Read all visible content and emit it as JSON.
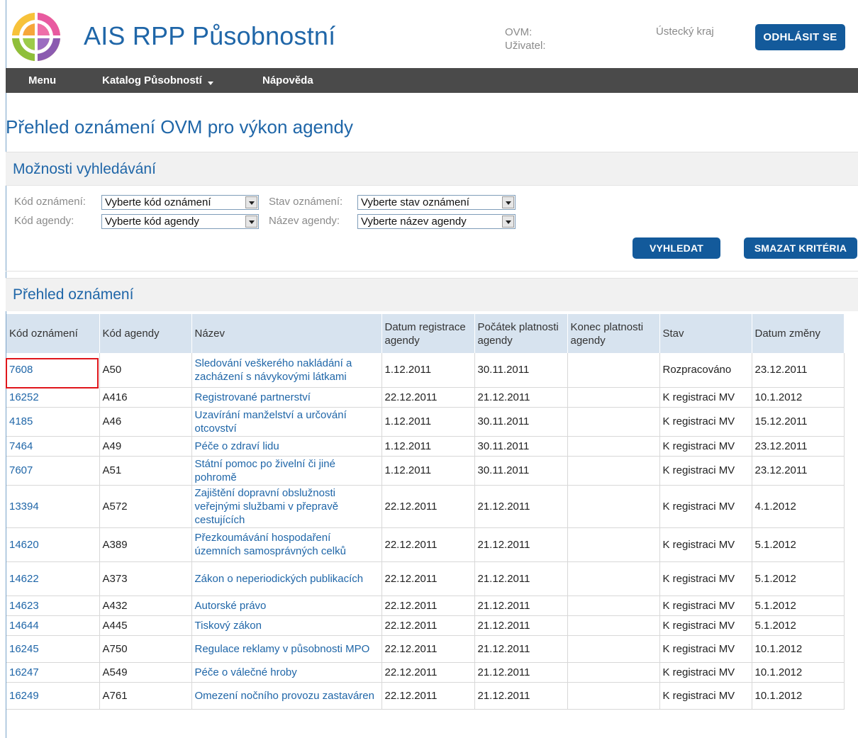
{
  "header": {
    "app_title": "AIS RPP Působnostní",
    "ovm_label": "OVM:",
    "user_label": "Uživatel:",
    "region": "Ústecký kraj",
    "logout_label": "ODHLÁSIT SE"
  },
  "nav": {
    "items": [
      {
        "label": "Menu"
      },
      {
        "label": "Katalog Působností"
      },
      {
        "label": "Nápověda"
      }
    ]
  },
  "page_title": "Přehled oznámení OVM pro výkon agendy",
  "search": {
    "title": "Možnosti vyhledávání",
    "kod_oznameni_label": "Kód oznámení:",
    "kod_oznameni_value": "Vyberte kód oznámení",
    "kod_agendy_label": "Kód agendy:",
    "kod_agendy_value": "Vyberte kód agendy",
    "stav_label": "Stav oznámení:",
    "stav_value": "Vyberte stav oznámení",
    "nazev_label": "Název agendy:",
    "nazev_value": "Vyberte název agendy",
    "search_button": "VYHLEDAT",
    "clear_button": "SMAZAT KRITÉRIA"
  },
  "results": {
    "title": "Přehled oznámení",
    "columns": [
      "Kód oznámení",
      "Kód agendy",
      "Název",
      "Datum registrace agendy",
      "Počátek platnosti agendy",
      "Konec platnosti agendy",
      "Stav",
      "Datum změny"
    ],
    "rows": [
      [
        "7608",
        "A50",
        "Sledování veškerého nakládání a zacházení s návykovými látkami",
        "1.12.2011",
        "30.11.2011",
        "",
        "Rozpracováno",
        "23.12.2011"
      ],
      [
        "16252",
        "A416",
        "Registrované partnerství",
        "22.12.2011",
        "21.12.2011",
        "",
        "K registraci MV",
        "10.1.2012"
      ],
      [
        "4185",
        "A46",
        "Uzavírání manželství a určování otcovství",
        "1.12.2011",
        "30.11.2011",
        "",
        "K registraci MV",
        "15.12.2011"
      ],
      [
        "7464",
        "A49",
        "Péče o zdraví lidu",
        "1.12.2011",
        "30.11.2011",
        "",
        "K registraci MV",
        "23.12.2011"
      ],
      [
        "7607",
        "A51",
        "Státní pomoc po živelní či jiné pohromě",
        "1.12.2011",
        "30.11.2011",
        "",
        "K registraci MV",
        "23.12.2011"
      ],
      [
        "13394",
        "A572",
        "Zajištění dopravní obslužnosti veřejnými službami v přepravě cestujících",
        "22.12.2011",
        "21.12.2011",
        "",
        "K registraci MV",
        "4.1.2012"
      ],
      [
        "14620",
        "A389",
        "Přezkoumávání hospodaření územních samosprávných celků",
        "22.12.2011",
        "21.12.2011",
        "",
        "K registraci MV",
        "5.1.2012"
      ],
      [
        "14622",
        "A373",
        "Zákon o neperiodických publikacích",
        "22.12.2011",
        "21.12.2011",
        "",
        "K registraci MV",
        "5.1.2012"
      ],
      [
        "14623",
        "A432",
        "Autorské právo",
        "22.12.2011",
        "21.12.2011",
        "",
        "K registraci MV",
        "5.1.2012"
      ],
      [
        "14644",
        "A445",
        "Tiskový zákon",
        "22.12.2011",
        "21.12.2011",
        "",
        "K registraci MV",
        "5.1.2012"
      ],
      [
        "16245",
        "A750",
        "Regulace reklamy v působnosti MPO",
        "22.12.2011",
        "21.12.2011",
        "",
        "K registraci MV",
        "10.1.2012"
      ],
      [
        "16247",
        "A549",
        "Péče o válečné hroby",
        "22.12.2011",
        "21.12.2011",
        "",
        "K registraci MV",
        "10.1.2012"
      ],
      [
        "16249",
        "A761",
        "Omezení nočního provozu zastaváren",
        "22.12.2011",
        "21.12.2011",
        "",
        "K registraci MV",
        "10.1.2012"
      ]
    ]
  },
  "colors": {
    "brand_blue": "#1f66a8",
    "button_blue": "#135a9b",
    "nav_bg": "#4a4a4a",
    "header_row_bg": "#d7e3ef",
    "highlight_red": "#e0161b"
  }
}
